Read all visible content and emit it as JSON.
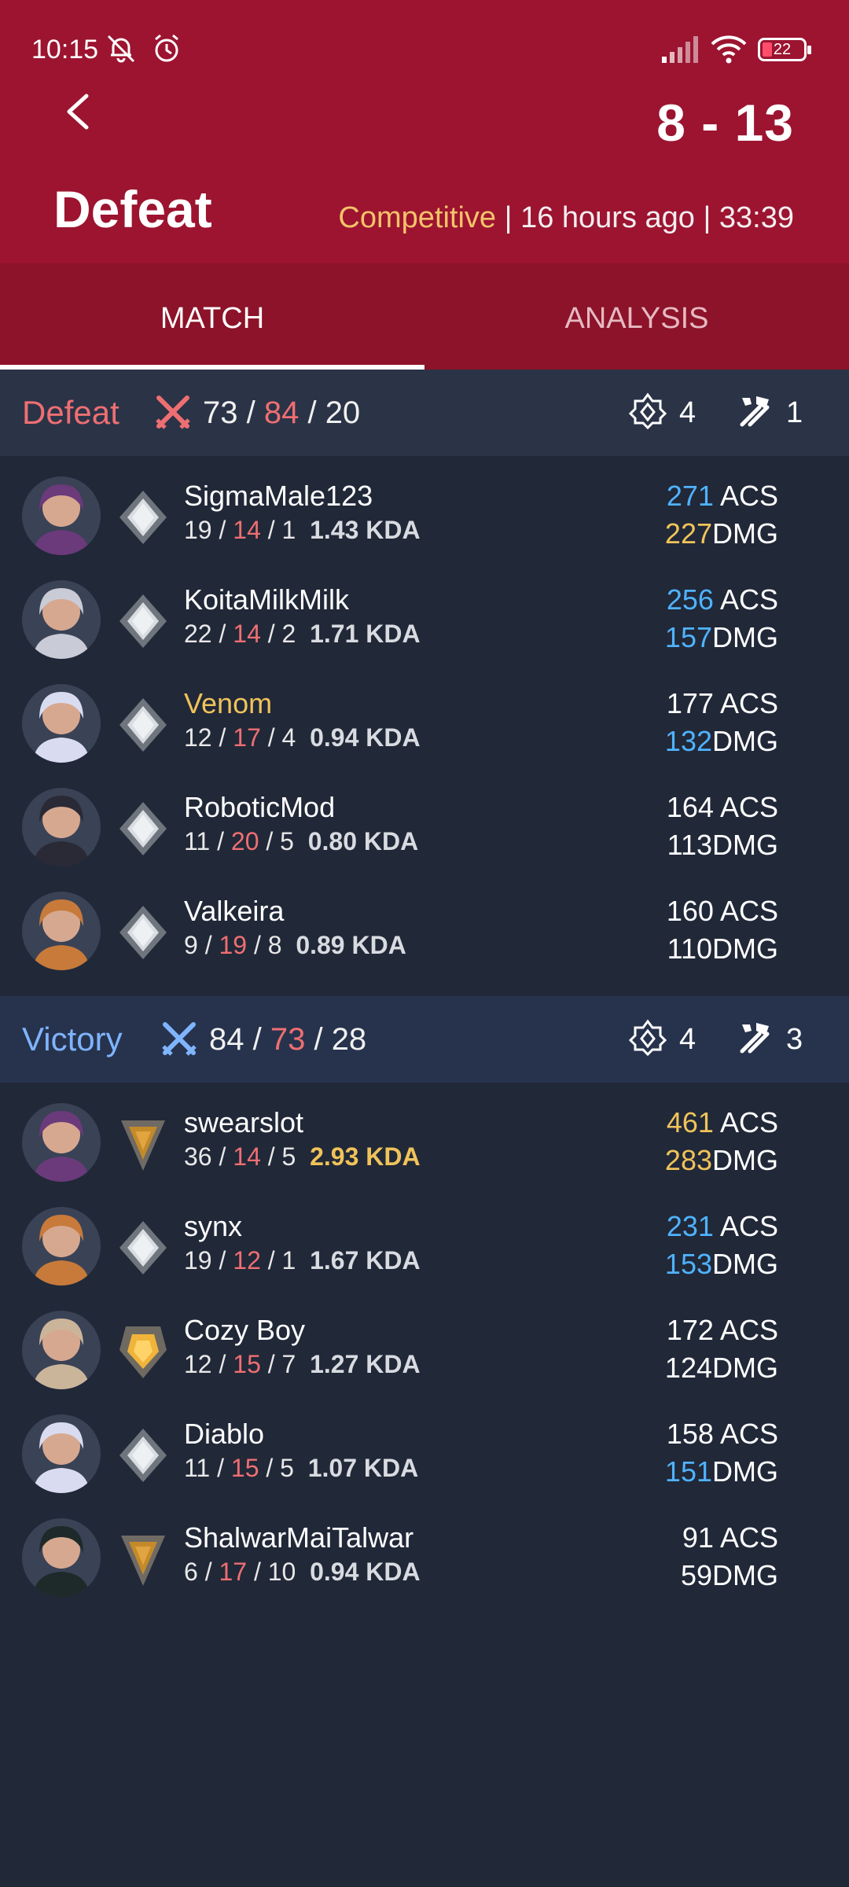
{
  "status": {
    "time": "10:15",
    "battery": "22"
  },
  "header": {
    "score": "8 - 13",
    "result": "Defeat",
    "mode": "Competitive",
    "sep1": " | ",
    "ago": "16 hours ago",
    "sep2": " | ",
    "duration": "33:39"
  },
  "tabs": {
    "match": "MATCH",
    "analysis": "ANALYSIS"
  },
  "teams": [
    {
      "name": "Defeat",
      "kills": "73",
      "deaths": "84",
      "assists": "20",
      "plants": "4",
      "defuses": "1",
      "players": [
        {
          "name": "SigmaMale123",
          "k": "19",
          "d": "14",
          "a": "1",
          "kda": "1.43 KDA",
          "acs": "271",
          "acs_label": " ACS",
          "dmg": "227",
          "dmg_label": "DMG"
        },
        {
          "name": "KoitaMilkMilk",
          "k": "22",
          "d": "14",
          "a": "2",
          "kda": "1.71 KDA",
          "acs": "256",
          "acs_label": " ACS",
          "dmg": "157",
          "dmg_label": "DMG"
        },
        {
          "name": "Venom",
          "k": "12",
          "d": "17",
          "a": "4",
          "kda": "0.94 KDA",
          "acs": "177",
          "acs_label": " ACS",
          "dmg": "132",
          "dmg_label": "DMG"
        },
        {
          "name": "RoboticMod",
          "k": "11",
          "d": "20",
          "a": "5",
          "kda": "0.80 KDA",
          "acs": "164",
          "acs_label": " ACS",
          "dmg": "113",
          "dmg_label": "DMG"
        },
        {
          "name": "Valkeira",
          "k": "9",
          "d": "19",
          "a": "8",
          "kda": "0.89 KDA",
          "acs": "160",
          "acs_label": " ACS",
          "dmg": "110",
          "dmg_label": "DMG"
        }
      ]
    },
    {
      "name": "Victory",
      "kills": "84",
      "deaths": "73",
      "assists": "28",
      "plants": "4",
      "defuses": "3",
      "players": [
        {
          "name": "swearslot",
          "k": "36",
          "d": "14",
          "a": "5",
          "kda": "2.93 KDA",
          "acs": "461",
          "acs_label": " ACS",
          "dmg": "283",
          "dmg_label": "DMG"
        },
        {
          "name": "synx",
          "k": "19",
          "d": "12",
          "a": "1",
          "kda": "1.67 KDA",
          "acs": "231",
          "acs_label": " ACS",
          "dmg": "153",
          "dmg_label": "DMG"
        },
        {
          "name": "Cozy Boy",
          "k": "12",
          "d": "15",
          "a": "7",
          "kda": "1.27 KDA",
          "acs": "172",
          "acs_label": " ACS",
          "dmg": "124",
          "dmg_label": "DMG"
        },
        {
          "name": "Diablo",
          "k": "11",
          "d": "15",
          "a": "5",
          "kda": "1.07 KDA",
          "acs": "158",
          "acs_label": " ACS",
          "dmg": "151",
          "dmg_label": "DMG"
        },
        {
          "name": "ShalwarMaiTalwar",
          "k": "6",
          "d": "17",
          "a": "10",
          "kda": "0.94 KDA",
          "acs": "91",
          "acs_label": " ACS",
          "dmg": "59",
          "dmg_label": "DMG"
        }
      ]
    }
  ],
  "kda_sep": " / ",
  "colors": {
    "header": "#9c1430",
    "tabs": "#8c1329",
    "background": "#212838",
    "defeat": "#ee6f72",
    "victory": "#7fb4ff",
    "highlight_blue": "#4fb3ff",
    "highlight_gold": "#f0c35a"
  }
}
